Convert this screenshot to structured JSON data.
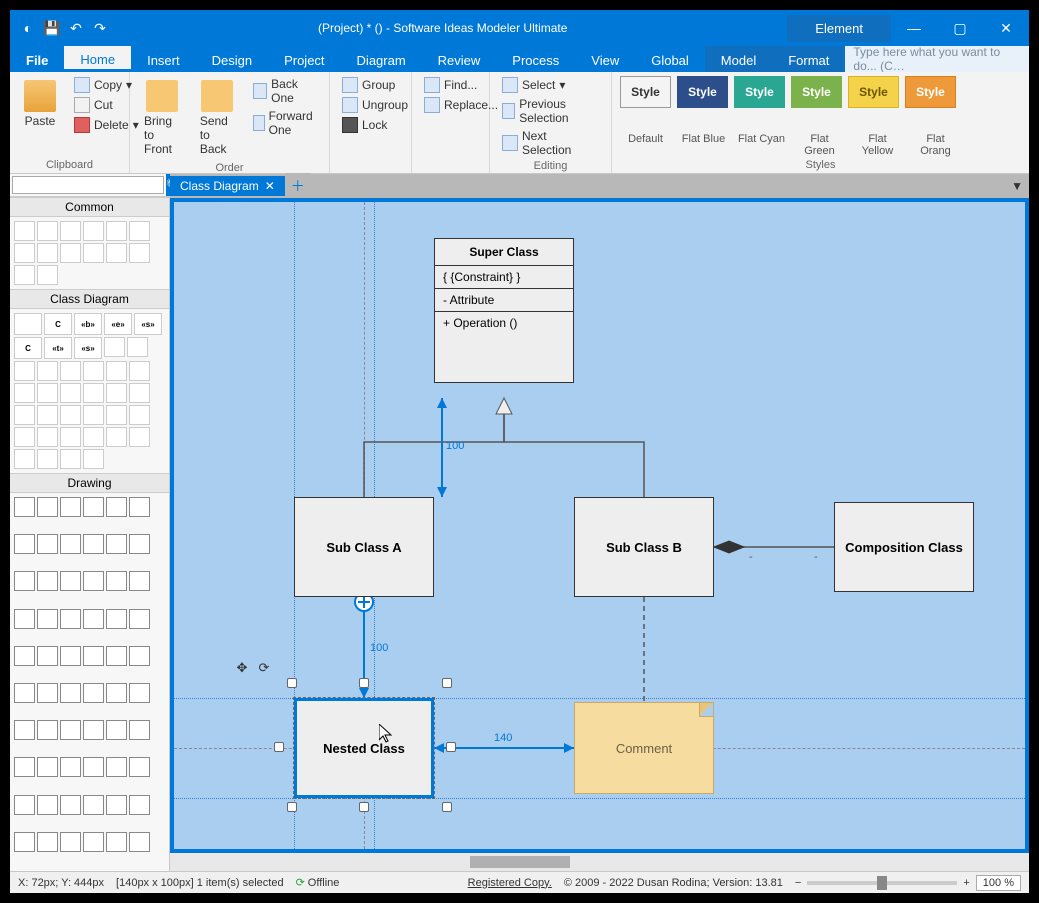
{
  "window": {
    "title": "(Project) *  ()  - Software Ideas Modeler Ultimate",
    "contextTab": "Element"
  },
  "menu": {
    "items": [
      "File",
      "Home",
      "Insert",
      "Design",
      "Project",
      "Diagram",
      "Review",
      "Process",
      "View",
      "Global",
      "Model",
      "Format"
    ],
    "active": "Home",
    "searchPlaceholder": "Type here what you want to do...   (C…"
  },
  "ribbon": {
    "clipboard": {
      "label": "Clipboard",
      "paste": "Paste",
      "copy": "Copy",
      "cut": "Cut",
      "delete": "Delete"
    },
    "order": {
      "label": "Order",
      "bringFront": "Bring to Front",
      "sendBack": "Send to Back",
      "backOne": "Back One",
      "forwardOne": "Forward One"
    },
    "groupg": {
      "group": "Group",
      "ungroup": "Ungroup",
      "lock": "Lock"
    },
    "findg": {
      "find": "Find...",
      "replace": "Replace..."
    },
    "editing": {
      "label": "Editing",
      "select": "Select",
      "prev": "Previous Selection",
      "next": "Next Selection"
    },
    "stylesGroupLabel": "Styles",
    "styles": [
      {
        "label": "Style",
        "name": "Default",
        "bg": "#f4f4f4",
        "fg": "#333",
        "border": "#999"
      },
      {
        "label": "Style",
        "name": "Flat Blue",
        "bg": "#2c4f8c",
        "fg": "#fff",
        "border": "#2c4f8c"
      },
      {
        "label": "Style",
        "name": "Flat Cyan",
        "bg": "#2aa792",
        "fg": "#fff",
        "border": "#2aa792"
      },
      {
        "label": "Style",
        "name": "Flat Green",
        "bg": "#7cb24b",
        "fg": "#fff",
        "border": "#7cb24b"
      },
      {
        "label": "Style",
        "name": "Flat Yellow",
        "bg": "#f4d24a",
        "fg": "#6b5500",
        "border": "#d8b420"
      },
      {
        "label": "Style",
        "name": "Flat Orang",
        "bg": "#ee9a3a",
        "fg": "#fff",
        "border": "#d87f1e"
      }
    ]
  },
  "sidebar": {
    "panels": {
      "common": "Common",
      "classDiagram": "Class Diagram",
      "drawing": "Drawing"
    }
  },
  "tabs": {
    "active": "Class Diagram"
  },
  "diagram": {
    "superClass": {
      "name": "Super Class",
      "constraint": "{ {Constraint}  }",
      "attribute": "- Attribute",
      "operation": "+ Operation ()"
    },
    "subA": "Sub Class A",
    "subB": "Sub Class B",
    "composition": "Composition Class",
    "nested": "Nested Class",
    "comment": "Comment",
    "dims": {
      "sa_to_super": "100",
      "nested_to_sa": "100",
      "nested_to_comment": "140"
    }
  },
  "status": {
    "coords": "X: 72px; Y: 444px",
    "sizesel": "[140px x 100px] 1 item(s) selected",
    "offline": "Offline",
    "regCopy": "Registered Copy.",
    "copyright": "© 2009 - 2022 Dusan Rodina; Version: 13.81",
    "zoom": "100 %"
  }
}
